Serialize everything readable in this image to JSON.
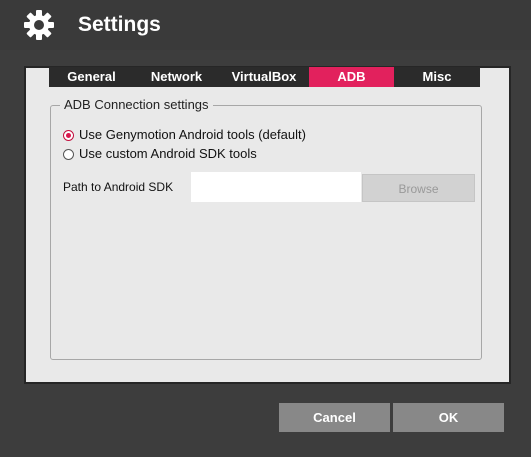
{
  "window": {
    "title": "Settings",
    "icon": "gear-icon"
  },
  "tabs": [
    {
      "label": "General",
      "active": false
    },
    {
      "label": "Network",
      "active": false
    },
    {
      "label": "VirtualBox",
      "active": false
    },
    {
      "label": "ADB",
      "active": true
    },
    {
      "label": "Misc",
      "active": false
    }
  ],
  "adb": {
    "group_title": "ADB Connection settings",
    "options": [
      {
        "label": "Use Genymotion Android tools (default)",
        "checked": true
      },
      {
        "label": "Use custom Android SDK tools",
        "checked": false
      }
    ],
    "sdk_path_label": "Path to Android SDK",
    "sdk_path_value": "",
    "browse_label": "Browse"
  },
  "footer": {
    "cancel_label": "Cancel",
    "ok_label": "OK"
  },
  "colors": {
    "accent": "#e2215d",
    "tab_bg": "#2b2b2b",
    "titlebar_bg": "#3a3a3a"
  }
}
